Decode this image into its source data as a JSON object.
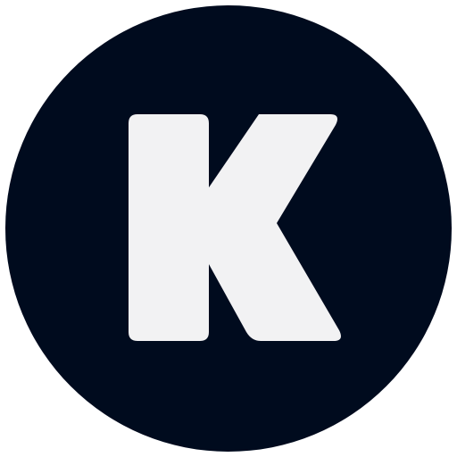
{
  "logo": {
    "letter": "K",
    "background_color": "#000b1e",
    "letter_color": "#f2f2f3",
    "page_background": "#ffffff"
  }
}
